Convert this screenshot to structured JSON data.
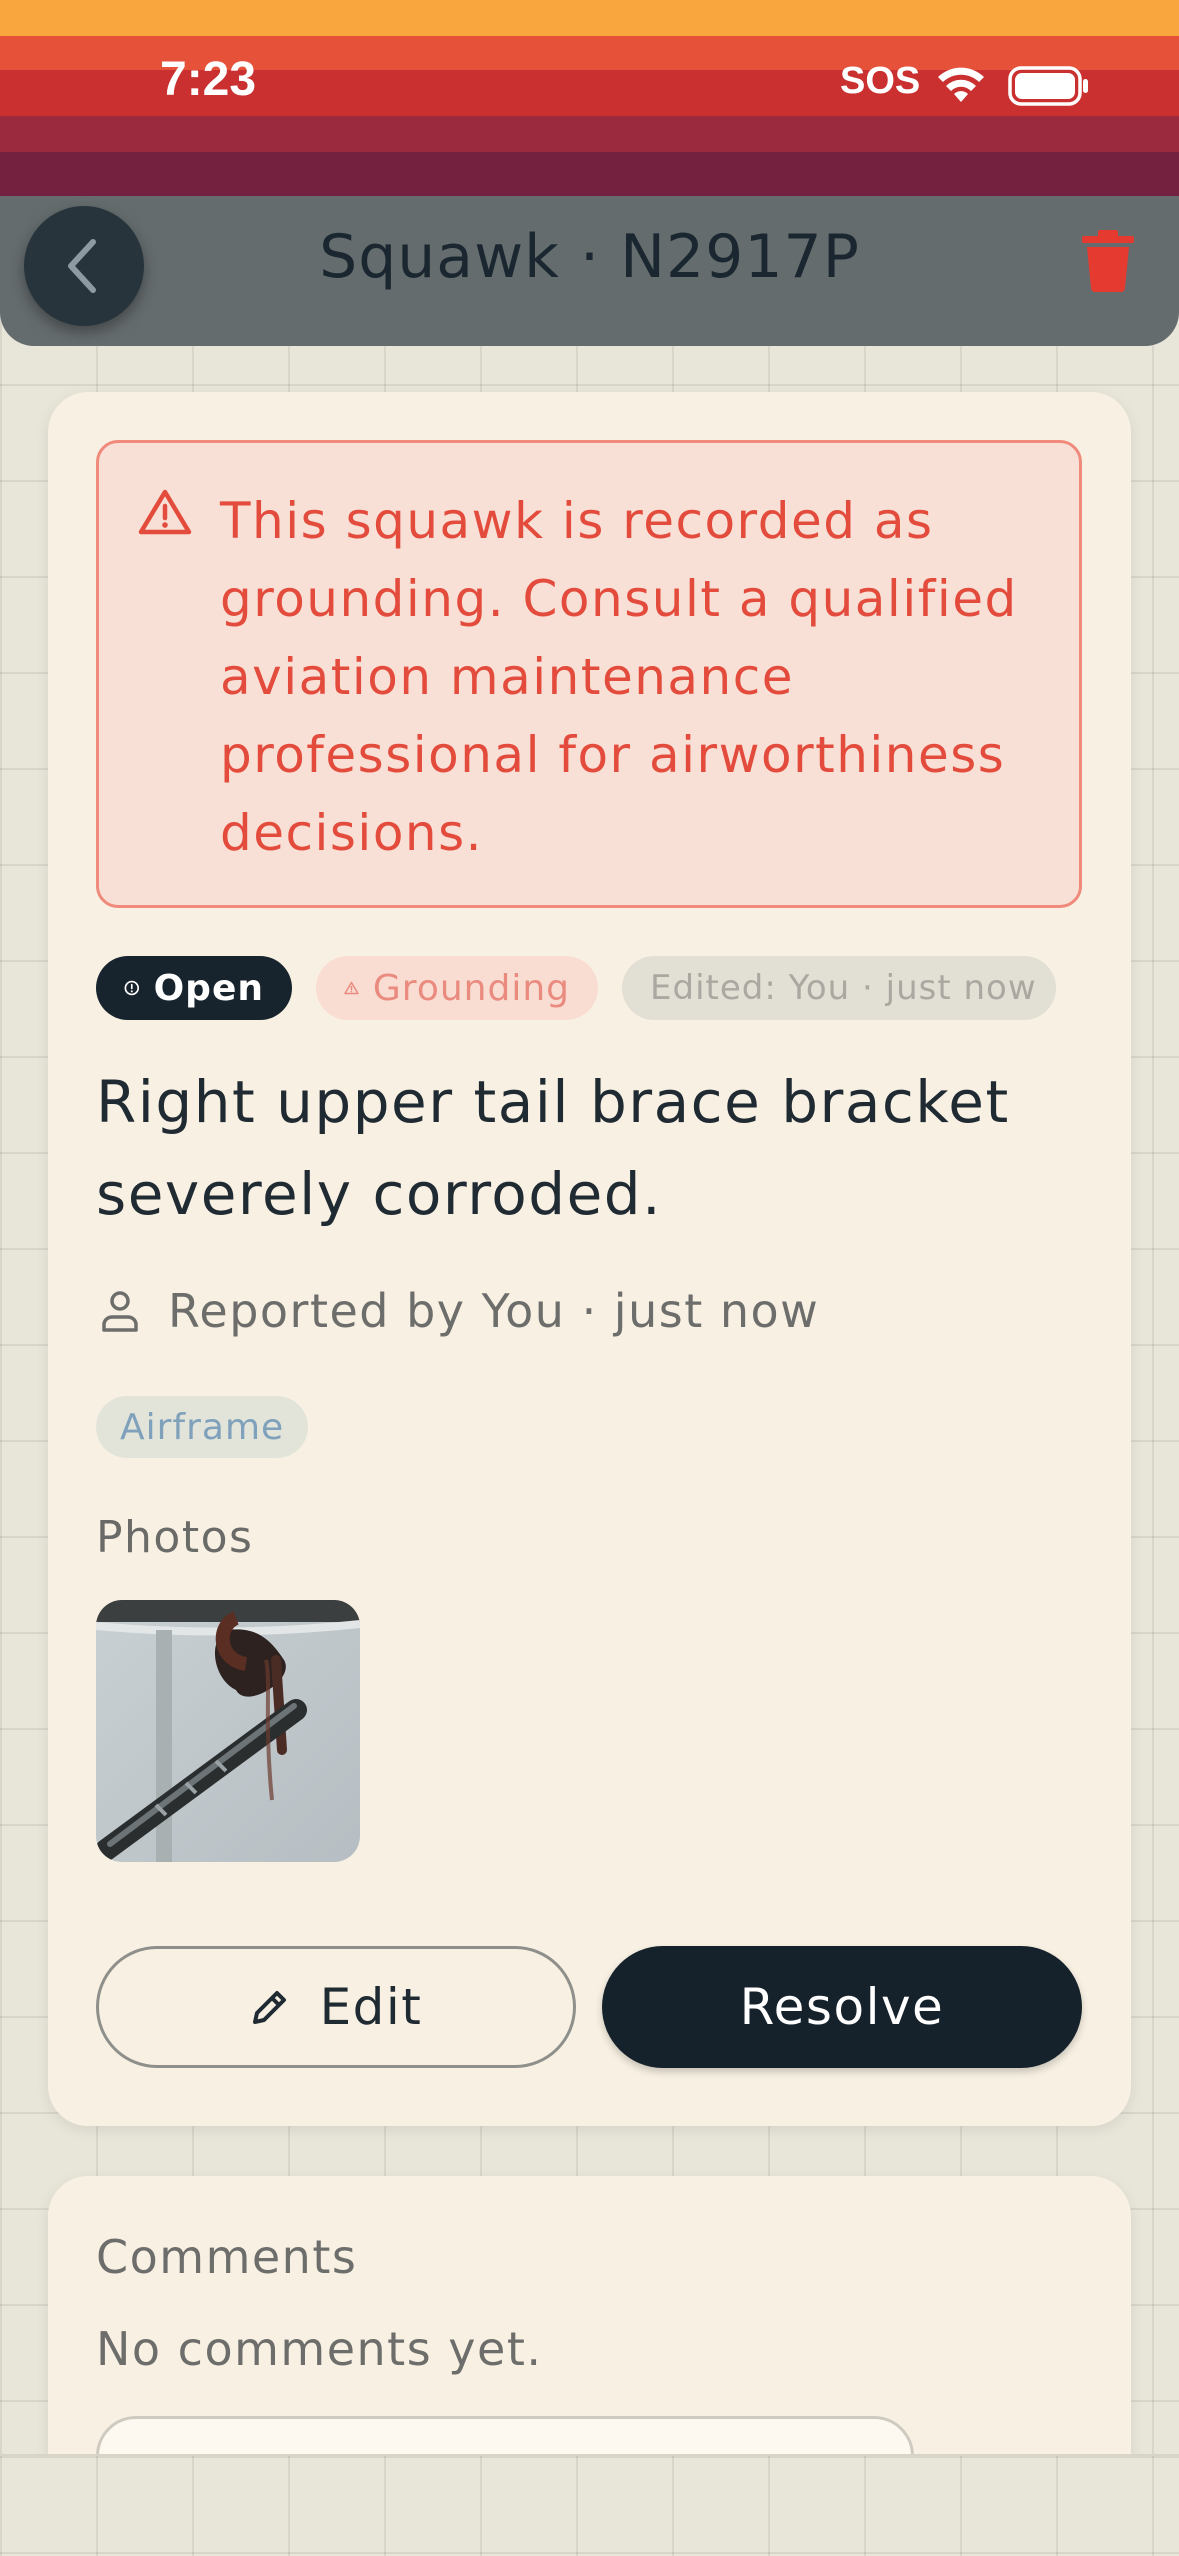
{
  "status_bar": {
    "time": "7:23",
    "carrier": "SOS",
    "icons": [
      "wifi-icon",
      "battery-icon"
    ]
  },
  "header": {
    "title": "Squawk · N2917P",
    "back_icon": "chevron-left-icon",
    "delete_icon": "trash-icon"
  },
  "alert": {
    "icon": "warning-triangle-icon",
    "text": "This squawk is recorded as grounding. Consult a qualified aviation maintenance professional for airworthiness decisions."
  },
  "badges": {
    "status": "Open",
    "status_icon": "alert-circle-icon",
    "grounding": "Grounding",
    "grounding_icon": "warning-triangle-icon",
    "edited": "Edited: You · just now"
  },
  "squawk": {
    "description": "Right upper tail brace bracket severely corroded.",
    "reported": "Reported by You · just now",
    "reported_icon": "person-icon",
    "category": "Airframe"
  },
  "photos": {
    "label": "Photos",
    "items": [
      {
        "alt": "corroded tail brace bracket photo"
      }
    ]
  },
  "actions": {
    "edit_label": "Edit",
    "edit_icon": "pencil-icon",
    "resolve_label": "Resolve"
  },
  "comments": {
    "title": "Comments",
    "empty_text": "No comments yet."
  },
  "colors": {
    "accent_dark": "#16222b",
    "alert_red": "#e34b3c",
    "card_bg": "#f8f1e3",
    "delete_red": "#e53a2f"
  }
}
